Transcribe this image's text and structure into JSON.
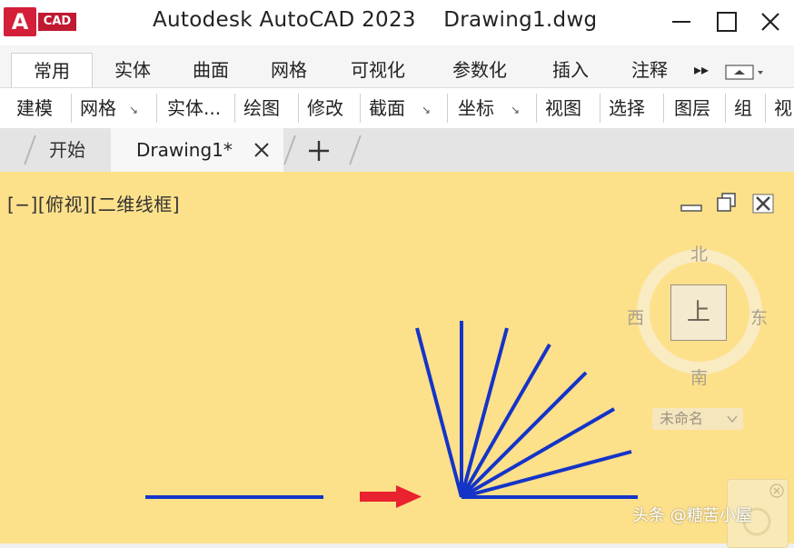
{
  "app": {
    "logo_letter": "A",
    "logo_text": "CAD",
    "window_title": "Autodesk AutoCAD 2023    Drawing1.dwg",
    "brand_color": "#d41f3a"
  },
  "ribbon_tabs": [
    {
      "label": "常用",
      "active": true
    },
    {
      "label": "实体"
    },
    {
      "label": "曲面"
    },
    {
      "label": "网格"
    },
    {
      "label": "可视化"
    },
    {
      "label": "参数化"
    },
    {
      "label": "插入"
    },
    {
      "label": "注释"
    }
  ],
  "ribbon_overflow": "▸▸",
  "ribbon_panels": [
    {
      "label": "建模",
      "arrow": false
    },
    {
      "label": "网格",
      "arrow": true
    },
    {
      "label": "实体...",
      "arrow": false
    },
    {
      "label": "绘图",
      "arrow": false
    },
    {
      "label": "修改",
      "arrow": false
    },
    {
      "label": "截面",
      "arrow": true
    },
    {
      "label": "坐标",
      "arrow": true
    },
    {
      "label": "视图",
      "arrow": false
    },
    {
      "label": "选择",
      "arrow": false
    },
    {
      "label": "图层",
      "arrow": false
    },
    {
      "label": "组",
      "arrow": false
    },
    {
      "label": "视",
      "arrow": false
    }
  ],
  "panel_arrow_glyph": "↘",
  "file_tabs": {
    "start": "开始",
    "document": "Drawing1*",
    "close_glyph": "✕",
    "new_tab_glyph": "+"
  },
  "viewport": {
    "label": "[−][俯视][二维线框]",
    "background": "#fde08a",
    "line_color": "#1434c8",
    "arrow_color": "#e8222e"
  },
  "viewcube": {
    "north": "北",
    "south": "南",
    "east": "东",
    "west": "西",
    "top": "上",
    "wcs": "未命名"
  },
  "watermark": "头条 @糖苦小屋"
}
